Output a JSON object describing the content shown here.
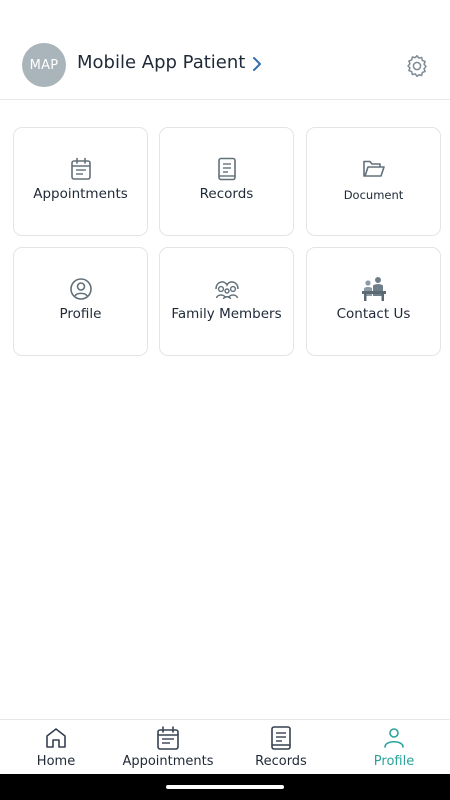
{
  "header": {
    "avatar_initials": "MAP",
    "user_name": "Mobile App Patient",
    "icons": {
      "chevron": "chevron-right-icon",
      "settings": "gear-icon"
    },
    "colors": {
      "avatar_bg": "#a9b4bb",
      "chevron": "#2f6fb0",
      "icon_gray": "#7e8c96"
    }
  },
  "tiles": [
    {
      "label": "Appointments",
      "icon": "calendar-icon"
    },
    {
      "label": "Records",
      "icon": "document-list-icon"
    },
    {
      "label": "Document",
      "icon": "folder-open-icon"
    },
    {
      "label": "Profile",
      "icon": "user-circle-icon"
    },
    {
      "label": "Family Members",
      "icon": "family-group-icon"
    },
    {
      "label": "Contact Us",
      "icon": "contact-desk-icon"
    }
  ],
  "bottom_nav": {
    "items": [
      {
        "label": "Home",
        "icon": "home-icon",
        "active": false
      },
      {
        "label": "Appointments",
        "icon": "calendar-icon",
        "active": false
      },
      {
        "label": "Records",
        "icon": "document-list-icon",
        "active": false
      },
      {
        "label": "Profile",
        "icon": "user-icon",
        "active": true
      }
    ],
    "active_color": "#2ba39a"
  }
}
